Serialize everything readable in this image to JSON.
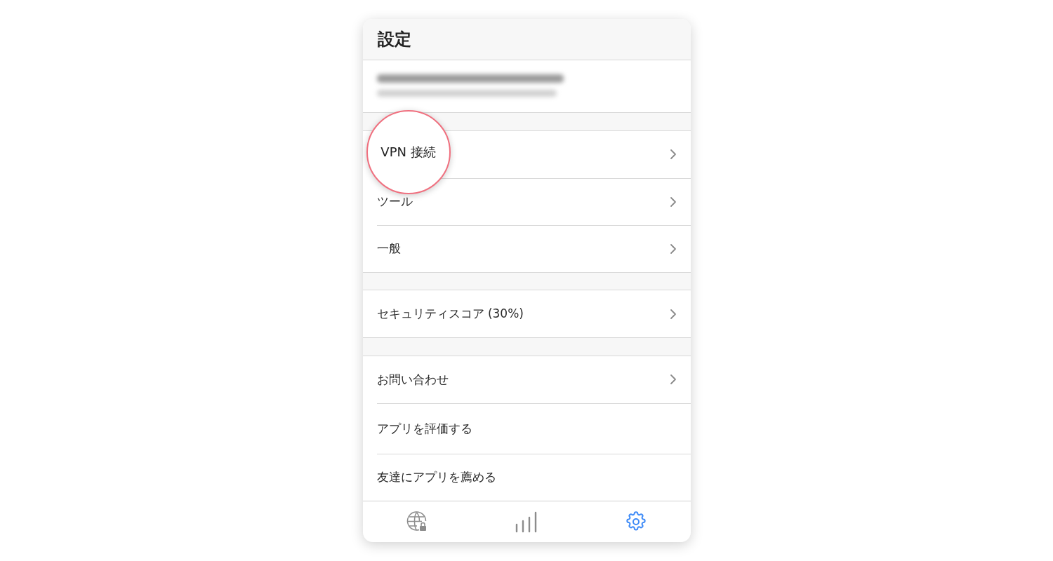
{
  "header": {
    "title": "設定"
  },
  "sections": [
    {
      "items": [
        {
          "label": "VPN 接続",
          "chevron": true,
          "highlighted": true
        },
        {
          "label": "ツール",
          "chevron": true,
          "highlighted": false
        },
        {
          "label": "一般",
          "chevron": true,
          "highlighted": false
        }
      ]
    },
    {
      "items": [
        {
          "label": "セキュリティスコア (30%)",
          "chevron": true,
          "highlighted": false
        }
      ]
    },
    {
      "items": [
        {
          "label": "お問い合わせ",
          "chevron": true,
          "highlighted": false
        },
        {
          "label": "アプリを評価する",
          "chevron": false,
          "highlighted": false
        },
        {
          "label": "友達にアプリを薦める",
          "chevron": false,
          "highlighted": false
        }
      ]
    }
  ],
  "tab_bar": [
    {
      "kind": "vpn",
      "selected": false
    },
    {
      "kind": "stats",
      "selected": false
    },
    {
      "kind": "settings",
      "selected": true
    }
  ]
}
